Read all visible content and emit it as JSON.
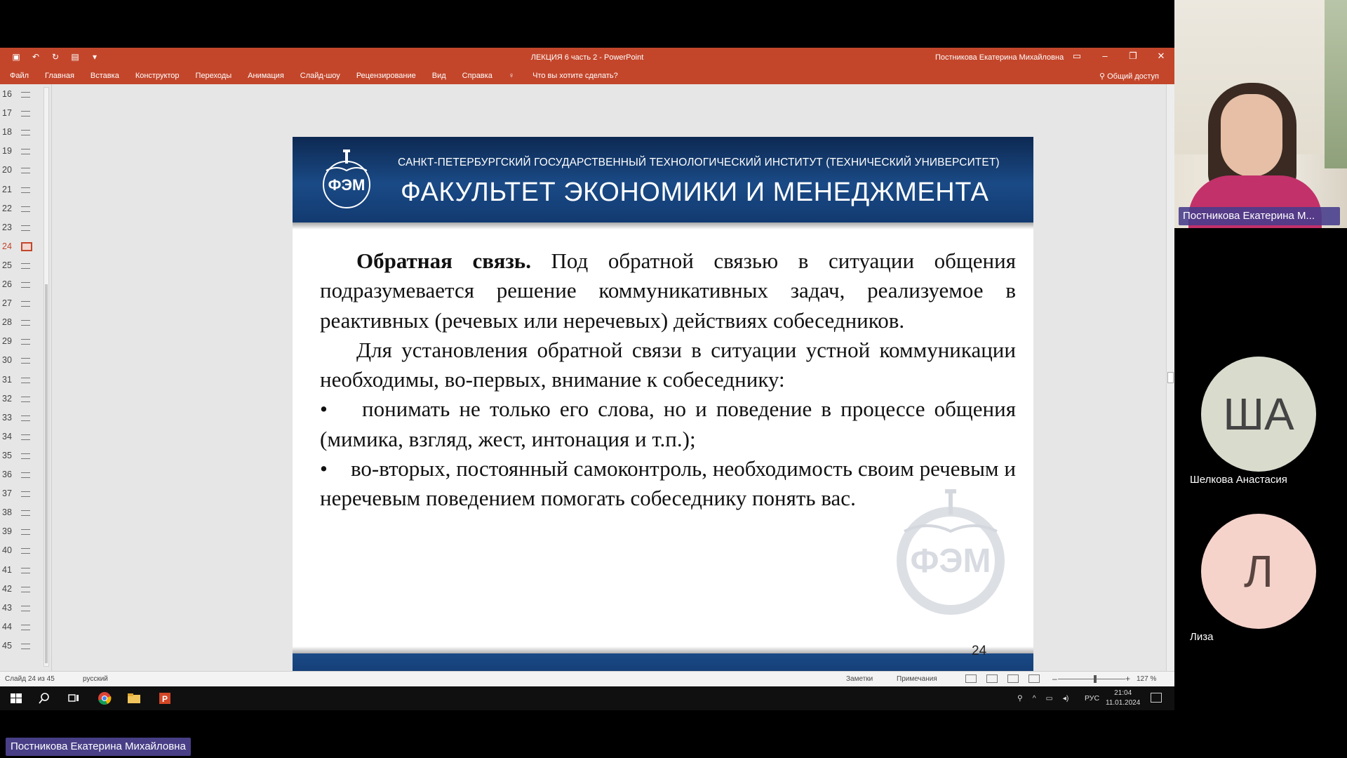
{
  "window": {
    "title": "ЛЕКЦИЯ 6 часть 2  -  PowerPoint",
    "user": "Постникова Екатерина Михайловна"
  },
  "ribbon": {
    "tabs": [
      "Файл",
      "Главная",
      "Вставка",
      "Конструктор",
      "Переходы",
      "Анимация",
      "Слайд-шоу",
      "Рецензирование",
      "Вид",
      "Справка"
    ],
    "tellme": "Что вы хотите сделать?",
    "share": "Общий доступ"
  },
  "thumbnails": {
    "slides": [
      "16",
      "17",
      "18",
      "19",
      "20",
      "21",
      "22",
      "23",
      "24",
      "25",
      "26",
      "27",
      "28",
      "29",
      "30",
      "31",
      "32",
      "33",
      "34",
      "35",
      "36",
      "37",
      "38",
      "39",
      "40",
      "41",
      "42",
      "43",
      "44",
      "45"
    ],
    "active": "24"
  },
  "slide": {
    "institute": "САНКТ-ПЕТЕРБУРГСКИЙ ГОСУДАРСТВЕННЫЙ ТЕХНОЛОГИЧЕСКИЙ ИНСТИТУТ (ТЕХНИЧЕСКИЙ УНИВЕРСИТЕТ)",
    "faculty": "ФАКУЛЬТЕТ ЭКОНОМИКИ И МЕНЕДЖМЕНТА",
    "logo_text": "ФЭМ",
    "logo_ring": "Факультет экономики и менеджмента",
    "p1_bold": "Обратная связь.",
    "p1_text": " Под обратной связью в ситуации общения подразумевается решение коммуникативных задач, реализуемое в реактивных (речевых или неречевых) действиях собеседников.",
    "p2_text": "Для установления обратной связи в ситуации устной коммуникации необходимы, во-первых, внимание к собеседнику:",
    "bullet_mark": "•",
    "b1_text": "понимать не только его слова, но и поведение в процессе общения (мимика, взгляд, жест, интонация и т.п.);",
    "b2_text": "во-вторых, постоянный самоконтроль, необходимость своим речевым и неречевым поведением помогать собеседнику понять вас.",
    "page_number": "24"
  },
  "statusbar": {
    "slide_info": "Слайд 24 из 45",
    "language": "русский",
    "notes": "Заметки",
    "comments": "Примечания",
    "zoom": "127 %"
  },
  "taskbar": {
    "lang": "РУС",
    "time": "21:04",
    "date": "11.01.2024"
  },
  "participants": {
    "presenter_tile_name": "Постникова Екатерина М...",
    "others": [
      {
        "initials": "ША",
        "name": "Шелкова Анастасия"
      },
      {
        "initials": "Л",
        "name": "Лиза"
      }
    ],
    "speaker_label": "Постникова Екатерина Михайловна"
  },
  "colors": {
    "ppt_accent": "#c3462b",
    "slide_blue": "#1a4a86"
  }
}
